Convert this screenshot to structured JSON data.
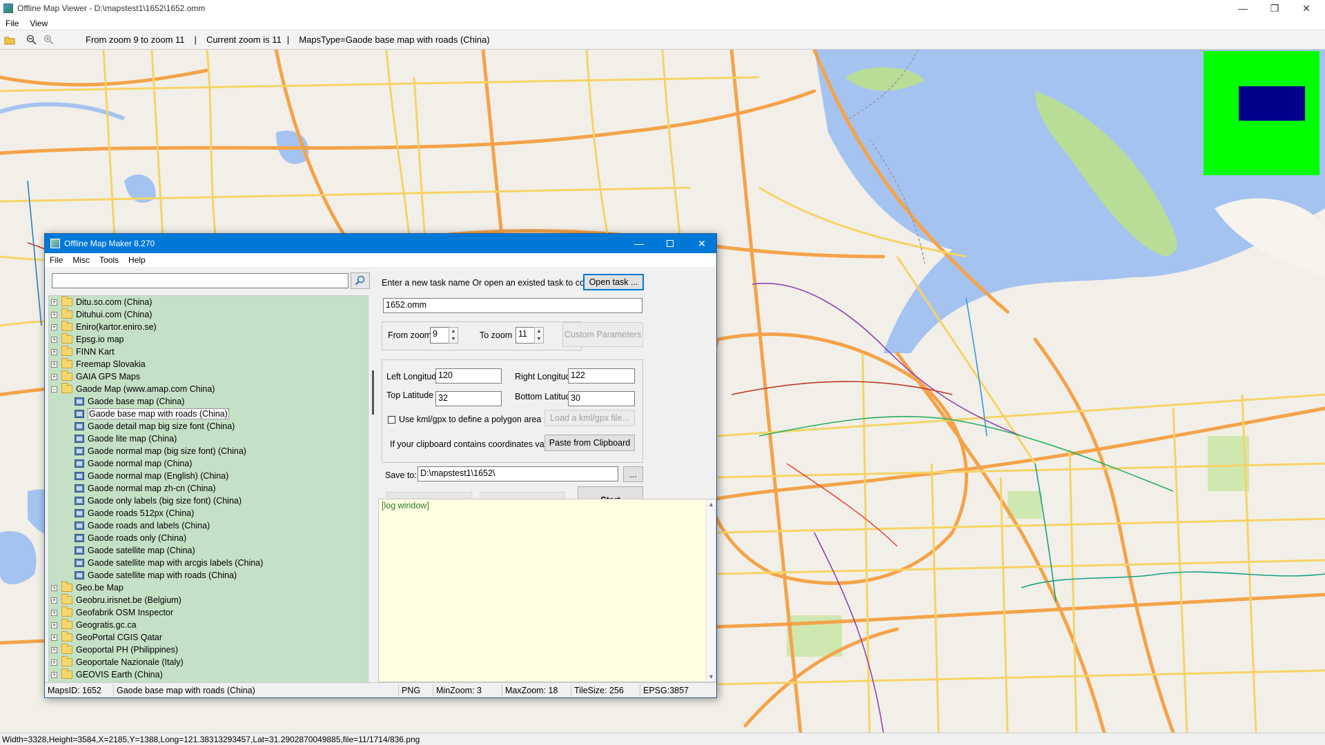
{
  "window": {
    "title": "Offline Map Viewer - D:\\mapstest1\\1652\\1652.omm",
    "minimize": "—",
    "maximize": "❐",
    "close": "✕"
  },
  "menubar": {
    "file": "File",
    "view": "View"
  },
  "toolbar": {
    "zoom_range": "From zoom 9 to zoom 11",
    "current_zoom": "Current zoom is 11",
    "maps_type": "MapsType=Gaode base map with roads (China)",
    "sep": "|"
  },
  "status": {
    "text": "Width=3328,Height=3584,X=2185,Y=1388,Long=121.38313293457,Lat=31.2902870049885,file=11/1714/836.png"
  },
  "colors": {
    "accent": "#0078d7",
    "tree_bg": "#c5e1c5",
    "log_bg": "#ffffe1",
    "minimap_bg": "#00ff00",
    "minimap_viewport": "#00008b",
    "water": "#a5c3f0",
    "major_road": "#f4a34a",
    "secondary_road": "#f6d365"
  },
  "dialog": {
    "title": "Offline Map Maker 8.270",
    "menu": {
      "file": "File",
      "misc": "Misc",
      "tools": "Tools",
      "help": "Help"
    },
    "search": {
      "value": "",
      "icon": "search-icon"
    },
    "tree": [
      {
        "label": "Ditu.so.com (China)",
        "expander": "+",
        "kind": "folder"
      },
      {
        "label": "Dituhui.com (China)",
        "expander": "+",
        "kind": "folder"
      },
      {
        "label": "Eniro(kartor.eniro.se)",
        "expander": "+",
        "kind": "folder"
      },
      {
        "label": "Epsg.io map",
        "expander": "+",
        "kind": "folder"
      },
      {
        "label": "FINN Kart",
        "expander": "+",
        "kind": "folder"
      },
      {
        "label": "Freemap Slovakia",
        "expander": "+",
        "kind": "folder"
      },
      {
        "label": "GAIA GPS Maps",
        "expander": "+",
        "kind": "folder"
      },
      {
        "label": "Gaode Map (www.amap.com China)",
        "expander": "−",
        "kind": "folder-open"
      },
      {
        "label": "Gaode base map (China)",
        "kind": "map"
      },
      {
        "label": "Gaode base map with roads (China)",
        "kind": "map",
        "selected": true
      },
      {
        "label": "Gaode detail map big size font (China)",
        "kind": "map"
      },
      {
        "label": "Gaode lite map (China)",
        "kind": "map"
      },
      {
        "label": "Gaode normal map (big size font) (China)",
        "kind": "map"
      },
      {
        "label": "Gaode normal map (China)",
        "kind": "map"
      },
      {
        "label": "Gaode normal map (English) (China)",
        "kind": "map"
      },
      {
        "label": "Gaode normal map zh-cn (China)",
        "kind": "map"
      },
      {
        "label": "Gaode only labels (big size font) (China)",
        "kind": "map"
      },
      {
        "label": "Gaode roads 512px (China)",
        "kind": "map"
      },
      {
        "label": "Gaode roads and labels (China)",
        "kind": "map"
      },
      {
        "label": "Gaode roads only (China)",
        "kind": "map"
      },
      {
        "label": "Gaode satellite map (China)",
        "kind": "map"
      },
      {
        "label": "Gaode satellite map with arcgis labels (China)",
        "kind": "map"
      },
      {
        "label": "Gaode satellite map with roads (China)",
        "kind": "map"
      },
      {
        "label": "Geo.be Map",
        "expander": "+",
        "kind": "folder"
      },
      {
        "label": "Geobru.irisnet.be (Belgium)",
        "expander": "+",
        "kind": "folder"
      },
      {
        "label": "Geofabrik OSM Inspector",
        "expander": "+",
        "kind": "folder"
      },
      {
        "label": "Geogratis.gc.ca",
        "expander": "+",
        "kind": "folder"
      },
      {
        "label": "GeoPortal CGIS Qatar",
        "expander": "+",
        "kind": "folder"
      },
      {
        "label": "Geoportal PH (Philippines)",
        "expander": "+",
        "kind": "folder"
      },
      {
        "label": "Geoportale Nazionale (Italy)",
        "expander": "+",
        "kind": "folder"
      },
      {
        "label": "GEOVIS Earth (China)",
        "expander": "+",
        "kind": "folder"
      }
    ],
    "task_prompt": "Enter a new task name Or open an existed task to continue:",
    "open_task": "Open task ...",
    "task_name": "1652.omm",
    "from_zoom_label": "From zoom",
    "from_zoom": "9",
    "to_zoom_label": "To zoom",
    "to_zoom": "11",
    "custom_params": "Custom Parameters",
    "left_lon_label": "Left Longitude",
    "left_lon": "120",
    "right_lon_label": "Right Longitude",
    "right_lon": "122",
    "top_lat_label": "Top Latitude",
    "top_lat": "32",
    "bottom_lat_label": "Bottom Latitude",
    "bottom_lat": "30",
    "kml_label": "Use kml/gpx to define a polygon area",
    "load_kml": "Load a kml/gpx file...",
    "clipboard_label": "If your clipboard contains coordinates values:",
    "paste_clipboard": "Paste from Clipboard",
    "save_to_label": "Save to:",
    "save_path": "D:\\mapstest1\\1652\\",
    "browse": "...",
    "start": "Start",
    "log_title": "[log window]",
    "statusbar": {
      "maps_id": "MapsID: 1652",
      "map_name": "Gaode base map with roads (China)",
      "format": "PNG",
      "min_zoom": "MinZoom: 3",
      "max_zoom": "MaxZoom: 18",
      "tile_size": "TileSize: 256",
      "epsg": "EPSG:3857"
    }
  }
}
